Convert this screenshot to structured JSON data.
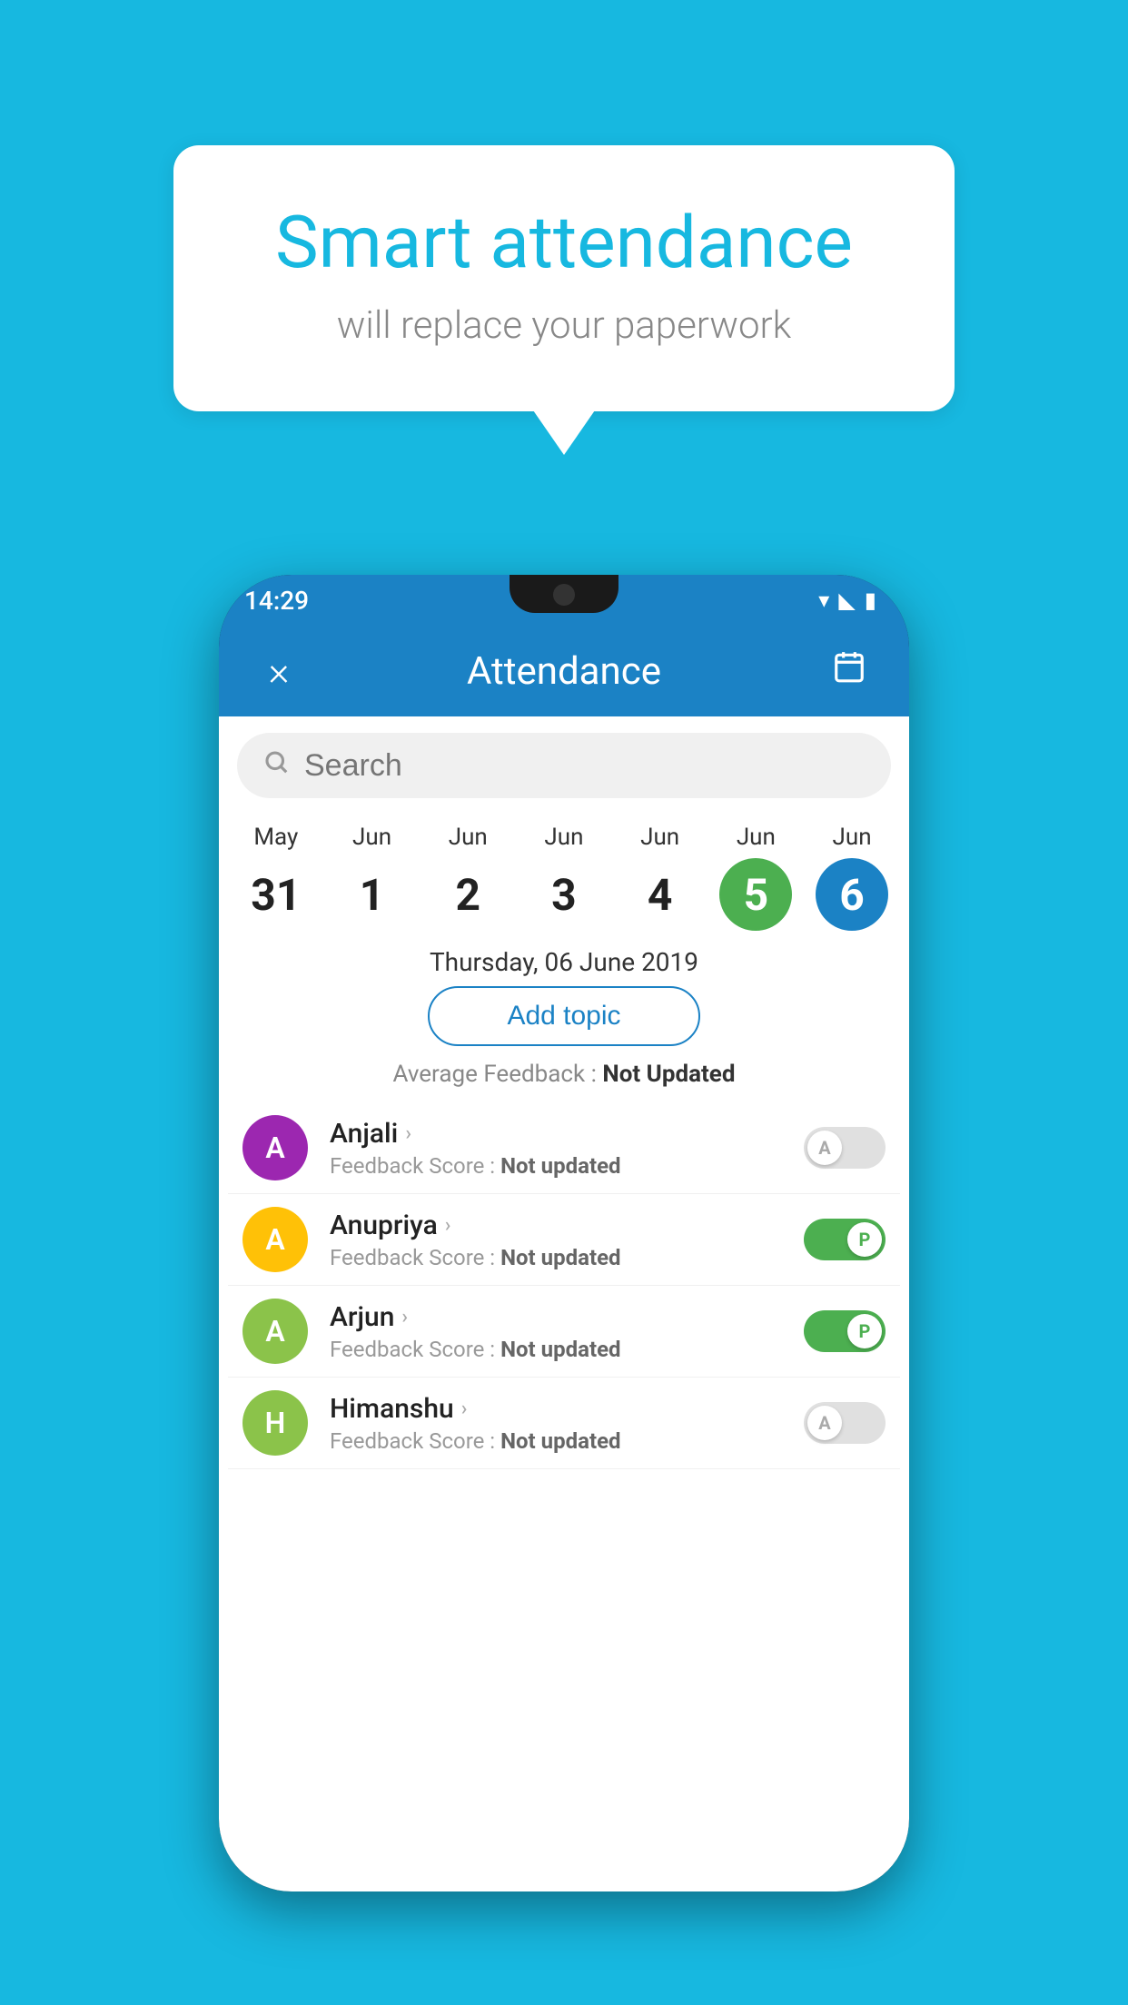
{
  "background_color": "#17B8E0",
  "hero": {
    "title": "Smart attendance",
    "subtitle": "will replace your paperwork"
  },
  "phone": {
    "status_bar": {
      "time": "14:29",
      "icons": [
        "wifi",
        "signal",
        "battery"
      ]
    },
    "app_bar": {
      "close_label": "×",
      "title": "Attendance",
      "calendar_icon": "📅"
    },
    "search": {
      "placeholder": "Search"
    },
    "dates": [
      {
        "month": "May",
        "day": "31",
        "style": "normal"
      },
      {
        "month": "Jun",
        "day": "1",
        "style": "normal"
      },
      {
        "month": "Jun",
        "day": "2",
        "style": "normal"
      },
      {
        "month": "Jun",
        "day": "3",
        "style": "normal"
      },
      {
        "month": "Jun",
        "day": "4",
        "style": "normal"
      },
      {
        "month": "Jun",
        "day": "5",
        "style": "today"
      },
      {
        "month": "Jun",
        "day": "6",
        "style": "selected"
      }
    ],
    "selected_date_label": "Thursday, 06 June 2019",
    "add_topic_label": "Add topic",
    "avg_feedback_label": "Average Feedback :",
    "avg_feedback_value": "Not Updated",
    "students": [
      {
        "name": "Anjali",
        "avatar_letter": "A",
        "avatar_color": "#9C27B0",
        "feedback": "Not updated",
        "attendance": "absent",
        "toggle_letter": "A"
      },
      {
        "name": "Anupriya",
        "avatar_letter": "A",
        "avatar_color": "#FFC107",
        "feedback": "Not updated",
        "attendance": "present",
        "toggle_letter": "P"
      },
      {
        "name": "Arjun",
        "avatar_letter": "A",
        "avatar_color": "#8BC34A",
        "feedback": "Not updated",
        "attendance": "present",
        "toggle_letter": "P"
      },
      {
        "name": "Himanshu",
        "avatar_letter": "H",
        "avatar_color": "#8BC34A",
        "feedback": "Not updated",
        "attendance": "absent",
        "toggle_letter": "A"
      }
    ]
  }
}
